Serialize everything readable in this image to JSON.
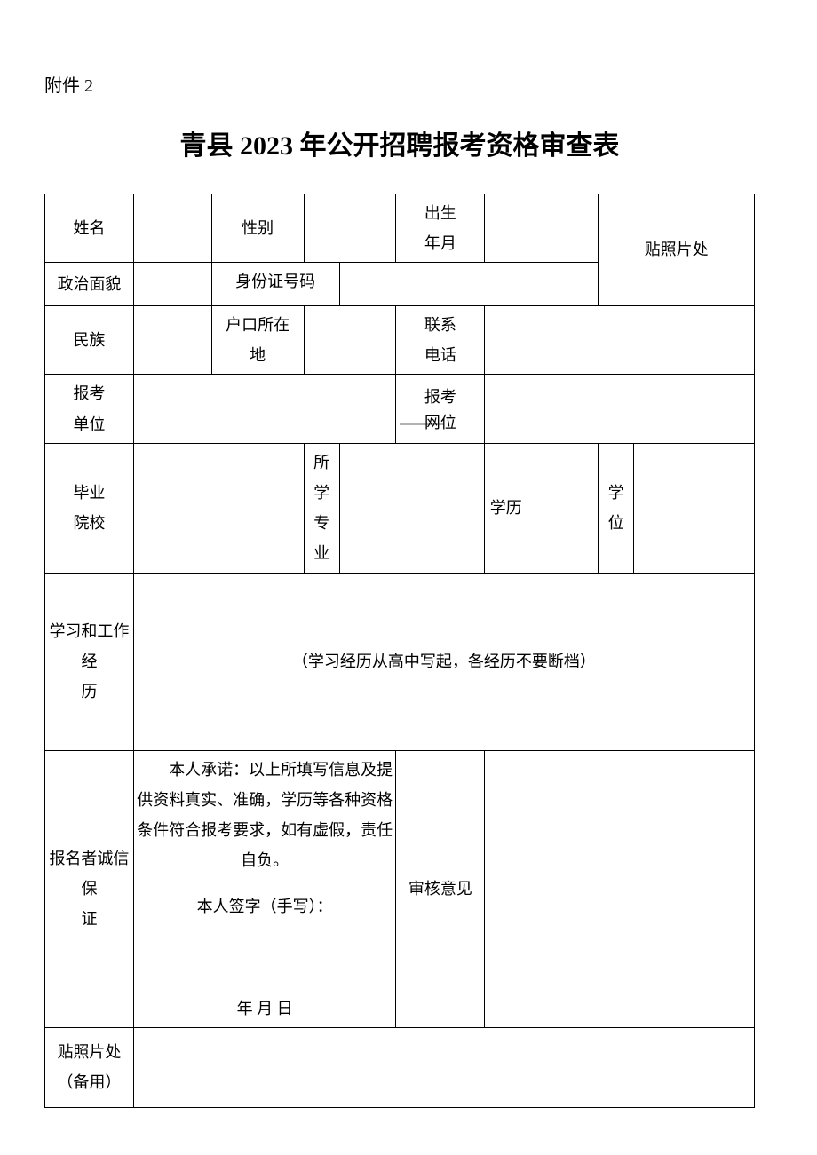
{
  "attachment_label": "附件 2",
  "title": "青县 2023 年公开招聘报考资格审查表",
  "labels": {
    "name": "姓名",
    "gender": "性别",
    "birth": "出生\n年月",
    "photo": "贴照片处",
    "political": "政治面貌",
    "id_number": "身份证号码",
    "ethnic": "民族",
    "household": "户口所在地",
    "phone": "联系\n电话",
    "apply_unit": "报考\n单位",
    "apply_position_prefix": "报考",
    "apply_position_suffix": "网位",
    "school": "毕业\n院校",
    "major": "所学\n专业",
    "education": "学历",
    "degree": "学位",
    "history": "学习和工作经历",
    "history_hint": "（学习经历从高中写起，各经历不要断档）",
    "integrity": "报名者诚信保证",
    "declaration": "本人承诺：以上所填写信息及提供资料真实、准确，学历等各种资格条件符合报考要求，如有虚假，责任自负。",
    "sign_line": "本人签字（手写）：",
    "date_line": "年 月 日",
    "review": "审核意见",
    "photo_spare": "贴照片处\n（备用）"
  }
}
